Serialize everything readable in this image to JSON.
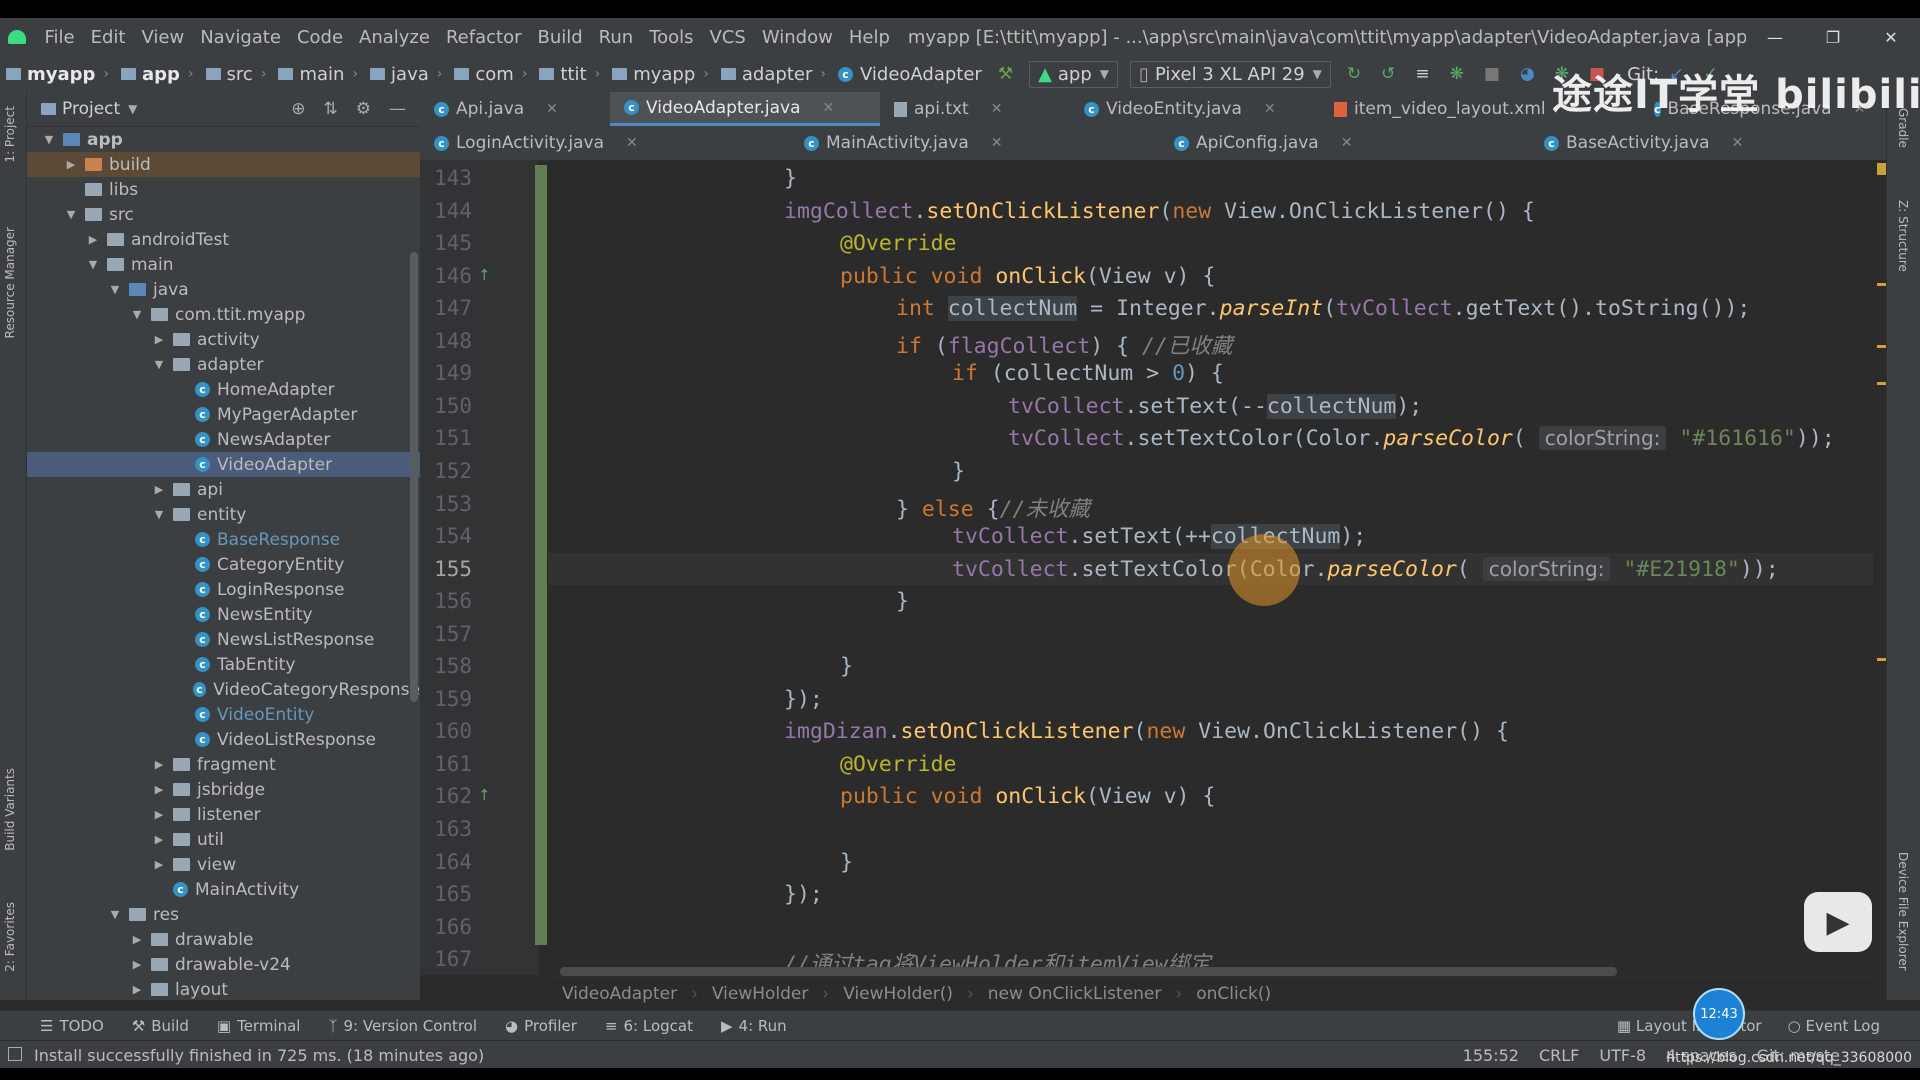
{
  "menu": {
    "items": [
      "File",
      "Edit",
      "View",
      "Navigate",
      "Code",
      "Analyze",
      "Refactor",
      "Build",
      "Run",
      "Tools",
      "VCS",
      "Window",
      "Help"
    ],
    "title": "myapp [E:\\ttit\\myapp] - ...\\app\\src\\main\\java\\com\\ttit\\myapp\\adapter\\VideoAdapter.java [app] - Android Studio"
  },
  "nav": {
    "crumbs": [
      "myapp",
      "app",
      "src",
      "main",
      "java",
      "com",
      "ttit",
      "myapp",
      "adapter",
      "VideoAdapter"
    ],
    "run_config": "app",
    "device": "Pixel 3 XL API 29",
    "git_label": "Git:"
  },
  "project_panel": {
    "title": "Project",
    "tree": [
      {
        "label": "app",
        "depth": 0,
        "type": "module",
        "open": true,
        "bold": true
      },
      {
        "label": "build",
        "depth": 1,
        "type": "folder-brown",
        "open": false,
        "state": "build"
      },
      {
        "label": "libs",
        "depth": 1,
        "type": "folder",
        "leaf": true
      },
      {
        "label": "src",
        "depth": 1,
        "type": "folder",
        "open": true
      },
      {
        "label": "androidTest",
        "depth": 2,
        "type": "folder",
        "open": false
      },
      {
        "label": "main",
        "depth": 2,
        "type": "folder",
        "open": true
      },
      {
        "label": "java",
        "depth": 3,
        "type": "folder-blue",
        "open": true
      },
      {
        "label": "com.ttit.myapp",
        "depth": 4,
        "type": "folder",
        "open": true
      },
      {
        "label": "activity",
        "depth": 5,
        "type": "folder",
        "open": false
      },
      {
        "label": "adapter",
        "depth": 5,
        "type": "folder",
        "open": true
      },
      {
        "label": "HomeAdapter",
        "depth": 6,
        "type": "class"
      },
      {
        "label": "MyPagerAdapter",
        "depth": 6,
        "type": "class"
      },
      {
        "label": "NewsAdapter",
        "depth": 6,
        "type": "class"
      },
      {
        "label": "VideoAdapter",
        "depth": 6,
        "type": "class",
        "selected": true
      },
      {
        "label": "api",
        "depth": 5,
        "type": "folder",
        "open": false
      },
      {
        "label": "entity",
        "depth": 5,
        "type": "folder",
        "open": true
      },
      {
        "label": "BaseResponse",
        "depth": 6,
        "type": "class",
        "blue": true
      },
      {
        "label": "CategoryEntity",
        "depth": 6,
        "type": "class"
      },
      {
        "label": "LoginResponse",
        "depth": 6,
        "type": "class"
      },
      {
        "label": "NewsEntity",
        "depth": 6,
        "type": "class"
      },
      {
        "label": "NewsListResponse",
        "depth": 6,
        "type": "class"
      },
      {
        "label": "TabEntity",
        "depth": 6,
        "type": "class"
      },
      {
        "label": "VideoCategoryResponse",
        "depth": 6,
        "type": "class"
      },
      {
        "label": "VideoEntity",
        "depth": 6,
        "type": "class",
        "blue": true
      },
      {
        "label": "VideoListResponse",
        "depth": 6,
        "type": "class"
      },
      {
        "label": "fragment",
        "depth": 5,
        "type": "folder",
        "open": false
      },
      {
        "label": "jsbridge",
        "depth": 5,
        "type": "folder",
        "open": false
      },
      {
        "label": "listener",
        "depth": 5,
        "type": "folder",
        "open": false
      },
      {
        "label": "util",
        "depth": 5,
        "type": "folder",
        "open": false
      },
      {
        "label": "view",
        "depth": 5,
        "type": "folder",
        "open": false
      },
      {
        "label": "MainActivity",
        "depth": 5,
        "type": "class",
        "leaf": true
      },
      {
        "label": "res",
        "depth": 3,
        "type": "folder",
        "open": true
      },
      {
        "label": "drawable",
        "depth": 4,
        "type": "folder",
        "open": false
      },
      {
        "label": "drawable-v24",
        "depth": 4,
        "type": "folder",
        "open": false
      },
      {
        "label": "layout",
        "depth": 4,
        "type": "folder",
        "open": false
      }
    ]
  },
  "tabs_row1": [
    {
      "label": "Api.java",
      "type": "class"
    },
    {
      "label": "VideoAdapter.java",
      "type": "class",
      "active": true
    },
    {
      "label": "api.txt",
      "type": "text"
    },
    {
      "label": "VideoEntity.java",
      "type": "class"
    },
    {
      "label": "item_video_layout.xml",
      "type": "xml"
    },
    {
      "label": "BaseResponse.java",
      "type": "class"
    }
  ],
  "tabs_row2": [
    {
      "label": "LoginActivity.java",
      "type": "class"
    },
    {
      "label": "MainActivity.java",
      "type": "class"
    },
    {
      "label": "ApiConfig.java",
      "type": "class"
    },
    {
      "label": "BaseActivity.java",
      "type": "class"
    }
  ],
  "editor": {
    "current_line": 155,
    "lines": [
      {
        "n": 143,
        "indent": 4,
        "tokens": [
          [
            "p",
            "}"
          ]
        ]
      },
      {
        "n": 144,
        "indent": 4,
        "tokens": [
          [
            "fld",
            "imgCollect"
          ],
          [
            "p",
            "."
          ],
          [
            "mth",
            "setOnClickListener"
          ],
          [
            "p",
            "("
          ],
          [
            "kw",
            "new "
          ],
          [
            "p",
            "View.OnClickListener() {"
          ]
        ]
      },
      {
        "n": 145,
        "indent": 8,
        "tokens": [
          [
            "ann",
            "@Override"
          ]
        ]
      },
      {
        "n": 146,
        "indent": 8,
        "marker": true,
        "tokens": [
          [
            "kw",
            "public void "
          ],
          [
            "mth",
            "onClick"
          ],
          [
            "p",
            "(View v) {"
          ]
        ]
      },
      {
        "n": 147,
        "indent": 12,
        "tokens": [
          [
            "kw",
            "int "
          ],
          [
            "hl",
            "collectNum"
          ],
          [
            "p",
            " = Integer."
          ],
          [
            "mthi",
            "parseInt"
          ],
          [
            "p",
            "("
          ],
          [
            "fld",
            "tvCollect"
          ],
          [
            "p",
            ".getText().toString());"
          ]
        ]
      },
      {
        "n": 148,
        "indent": 12,
        "tokens": [
          [
            "kw",
            "if "
          ],
          [
            "p",
            "("
          ],
          [
            "fld",
            "flagCollect"
          ],
          [
            "p",
            ") { "
          ],
          [
            "cmt",
            "//已收藏"
          ]
        ]
      },
      {
        "n": 149,
        "indent": 16,
        "tokens": [
          [
            "kw",
            "if "
          ],
          [
            "p",
            "(collectNum > "
          ],
          [
            "num",
            "0"
          ],
          [
            "p",
            ") {"
          ]
        ]
      },
      {
        "n": 150,
        "indent": 20,
        "tokens": [
          [
            "fld",
            "tvCollect"
          ],
          [
            "p",
            ".setText(--"
          ],
          [
            "hl",
            "collectNum"
          ],
          [
            "p",
            ");"
          ]
        ]
      },
      {
        "n": 151,
        "indent": 20,
        "tokens": [
          [
            "fld",
            "tvCollect"
          ],
          [
            "p",
            ".setTextColor(Color."
          ],
          [
            "mthi",
            "parseColor"
          ],
          [
            "p",
            "( "
          ],
          [
            "hint",
            "colorString:"
          ],
          [
            "str",
            " \"#161616\""
          ],
          [
            "p",
            "));"
          ]
        ]
      },
      {
        "n": 152,
        "indent": 16,
        "tokens": [
          [
            "p",
            "}"
          ]
        ]
      },
      {
        "n": 153,
        "indent": 12,
        "tokens": [
          [
            "p",
            "} "
          ],
          [
            "kw",
            "else "
          ],
          [
            "p",
            "{"
          ],
          [
            "cmt",
            "//未收藏"
          ]
        ]
      },
      {
        "n": 154,
        "indent": 16,
        "tokens": [
          [
            "fld",
            "tvCollect"
          ],
          [
            "p",
            ".setText(++"
          ],
          [
            "hl",
            "collectNum"
          ],
          [
            "p",
            ");"
          ]
        ]
      },
      {
        "n": 155,
        "indent": 16,
        "tokens": [
          [
            "fld",
            "tvCollect"
          ],
          [
            "p",
            ".setTextColor(Color."
          ],
          [
            "mthi",
            "parseColor"
          ],
          [
            "p",
            "( "
          ],
          [
            "hint",
            "colorString:"
          ],
          [
            "str",
            " \"#E21918\""
          ],
          [
            "p",
            "));"
          ]
        ]
      },
      {
        "n": 156,
        "indent": 12,
        "tokens": [
          [
            "p",
            "}"
          ]
        ]
      },
      {
        "n": 157,
        "indent": 0,
        "tokens": []
      },
      {
        "n": 158,
        "indent": 8,
        "tokens": [
          [
            "p",
            "}"
          ]
        ]
      },
      {
        "n": 159,
        "indent": 4,
        "tokens": [
          [
            "p",
            "});"
          ]
        ]
      },
      {
        "n": 160,
        "indent": 4,
        "tokens": [
          [
            "fld",
            "imgDizan"
          ],
          [
            "p",
            "."
          ],
          [
            "mth",
            "setOnClickListener"
          ],
          [
            "p",
            "("
          ],
          [
            "kw",
            "new "
          ],
          [
            "p",
            "View.OnClickListener() {"
          ]
        ]
      },
      {
        "n": 161,
        "indent": 8,
        "tokens": [
          [
            "ann",
            "@Override"
          ]
        ]
      },
      {
        "n": 162,
        "indent": 8,
        "marker": true,
        "tokens": [
          [
            "kw",
            "public void "
          ],
          [
            "mth",
            "onClick"
          ],
          [
            "p",
            "(View v) {"
          ]
        ]
      },
      {
        "n": 163,
        "indent": 0,
        "tokens": []
      },
      {
        "n": 164,
        "indent": 8,
        "tokens": [
          [
            "p",
            "}"
          ]
        ]
      },
      {
        "n": 165,
        "indent": 4,
        "tokens": [
          [
            "p",
            "});"
          ]
        ]
      },
      {
        "n": 166,
        "indent": 0,
        "tokens": []
      },
      {
        "n": 167,
        "indent": 4,
        "tokens": [
          [
            "cmt",
            "//通过tag将ViewHolder和itemView绑定"
          ]
        ]
      }
    ]
  },
  "code_breadcrumb": [
    "VideoAdapter",
    "ViewHolder",
    "ViewHolder()",
    "new OnClickListener",
    "onClick()"
  ],
  "tool_windows": {
    "left": [
      "TODO",
      "Build",
      "Terminal",
      "9: Version Control",
      "Profiler",
      "6: Logcat",
      "4: Run"
    ],
    "right": [
      "Layout Inspector",
      "Event Log"
    ]
  },
  "side_labels": {
    "left": [
      "1: Project",
      "Resource Manager",
      "Build Variants",
      "2: Favorites"
    ],
    "right": [
      "Gradle",
      "Z: Structure",
      "Device File Explorer"
    ]
  },
  "status": {
    "message": "Install successfully finished in 725 ms. (18 minutes ago)",
    "position": "155:52",
    "line_sep": "CRLF",
    "encoding": "UTF-8",
    "indent": "4 spaces",
    "vcs": "Git: maste"
  },
  "overlay": {
    "watermark": "途途IT学堂 bilibili",
    "time_badge": "12:43",
    "url": "https://blog.csdn.net/qq_33608000"
  },
  "colors": {
    "keyword": "#cc7832",
    "field": "#9876aa",
    "method": "#ffc66d",
    "string": "#6a8759",
    "number": "#6897bb",
    "annotation": "#bbb529",
    "comment": "#808080",
    "editor_bg": "#2b2b2b",
    "panel_bg": "#3c3f41",
    "selection": "#4b5b7a"
  }
}
